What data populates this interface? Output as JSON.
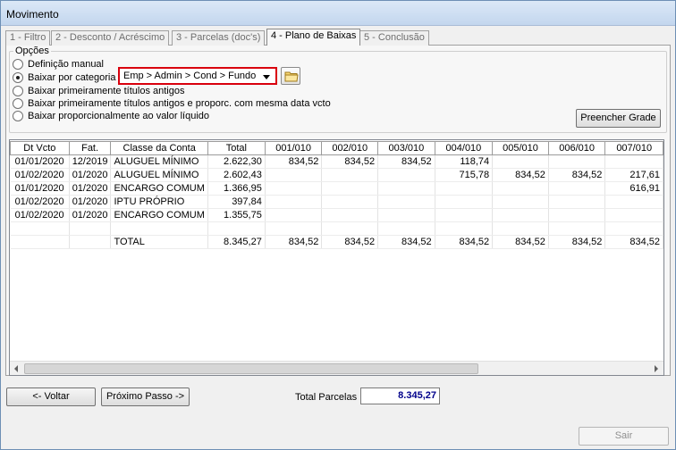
{
  "window": {
    "title": "Movimento"
  },
  "tabs": [
    {
      "label": "1 - Filtro",
      "active": false
    },
    {
      "label": "2 - Desconto / Acréscimo",
      "active": false
    },
    {
      "label": "3 - Parcelas (doc's)",
      "active": false
    },
    {
      "label": "4 - Plano de Baixas",
      "active": true
    },
    {
      "label": "5 - Conclusão",
      "active": false
    }
  ],
  "options": {
    "group_title": "Opções",
    "radios": [
      {
        "label": "Definição manual",
        "checked": false
      },
      {
        "label": "Baixar por categoria",
        "checked": true
      },
      {
        "label": "Baixar primeiramente títulos antigos",
        "checked": false
      },
      {
        "label": "Baixar primeiramente títulos antigos e proporc. com mesma data vcto",
        "checked": false
      },
      {
        "label": "Baixar proporcionalmente ao valor líquido",
        "checked": false
      }
    ],
    "category_select": {
      "value": "Emp > Admin > Cond > Fundo Pr"
    },
    "fill_grid_label": "Preencher Grade"
  },
  "grid": {
    "headers": [
      "Dt Vcto",
      "Fat.",
      "Classe da Conta",
      "Total",
      "001/010",
      "002/010",
      "003/010",
      "004/010",
      "005/010",
      "006/010",
      "007/010"
    ],
    "rows": [
      [
        "01/01/2020",
        "12/2019",
        "ALUGUEL MÍNIMO",
        "2.622,30",
        "834,52",
        "834,52",
        "834,52",
        "118,74",
        "",
        "",
        ""
      ],
      [
        "01/02/2020",
        "01/2020",
        "ALUGUEL MÍNIMO",
        "2.602,43",
        "",
        "",
        "",
        "715,78",
        "834,52",
        "834,52",
        "217,61"
      ],
      [
        "01/01/2020",
        "01/2020",
        "ENCARGO COMUM",
        "1.366,95",
        "",
        "",
        "",
        "",
        "",
        "",
        "616,91"
      ],
      [
        "01/02/2020",
        "01/2020",
        "IPTU PRÓPRIO",
        "397,84",
        "",
        "",
        "",
        "",
        "",
        "",
        ""
      ],
      [
        "01/02/2020",
        "01/2020",
        "ENCARGO COMUM",
        "1.355,75",
        "",
        "",
        "",
        "",
        "",
        "",
        ""
      ],
      [
        "",
        "",
        "",
        "",
        "",
        "",
        "",
        "",
        "",
        "",
        ""
      ],
      [
        "",
        "",
        "TOTAL",
        "8.345,27",
        "834,52",
        "834,52",
        "834,52",
        "834,52",
        "834,52",
        "834,52",
        "834,52"
      ]
    ]
  },
  "footer": {
    "back_label": "<- Voltar",
    "next_label": "Próximo Passo ->",
    "total_label": "Total Parcelas",
    "total_value": "8.345,27",
    "exit_label": "Sair"
  }
}
